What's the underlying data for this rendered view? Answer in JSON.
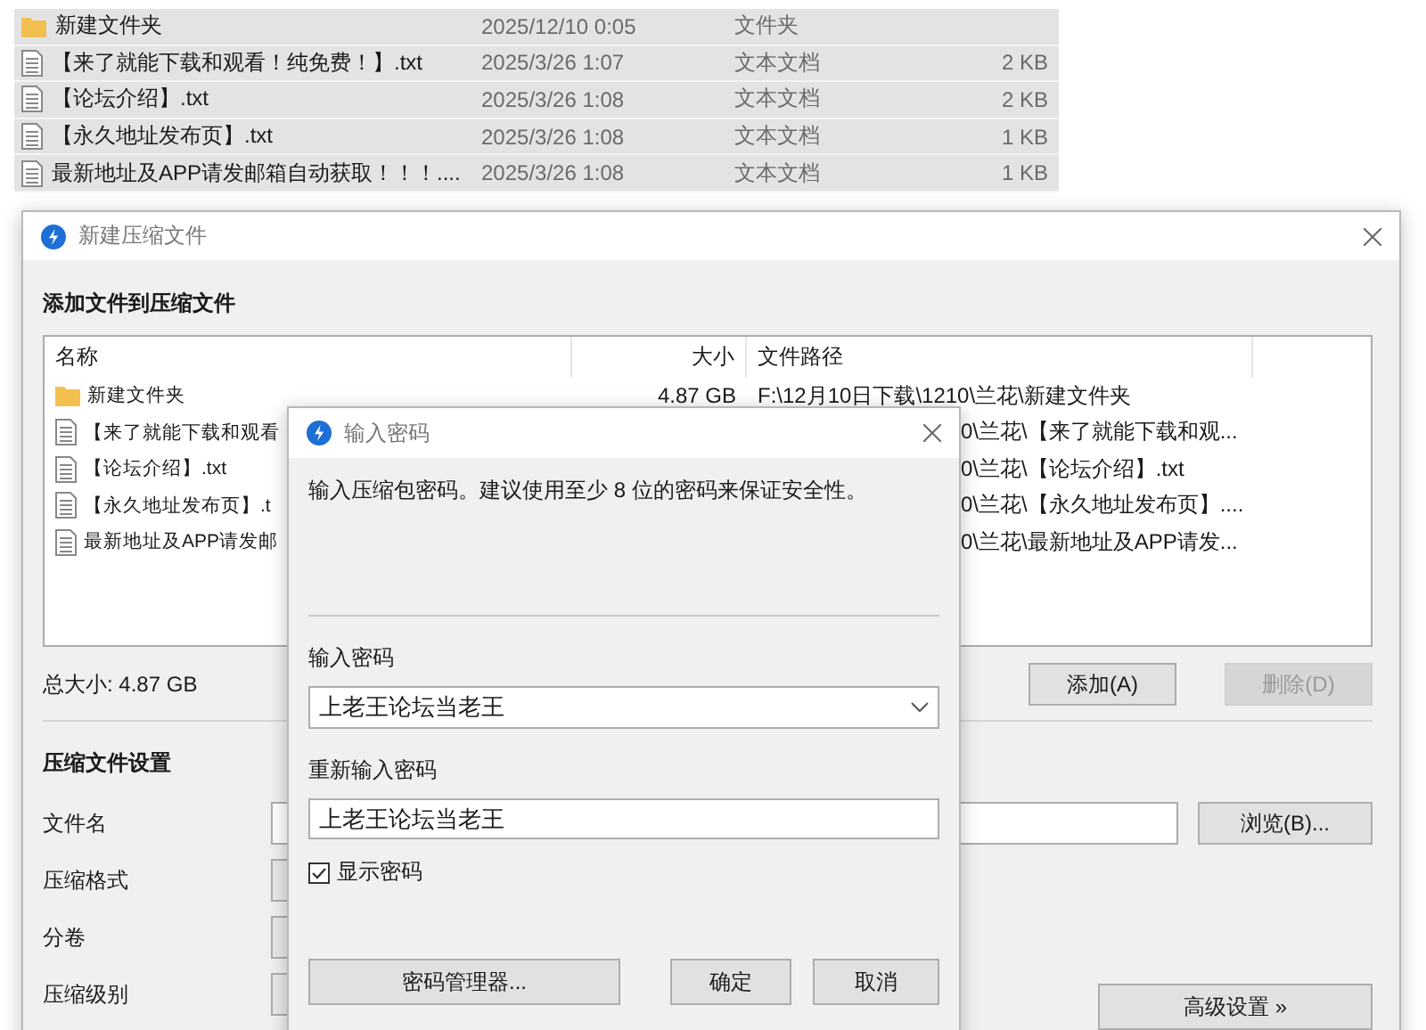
{
  "file_list": [
    {
      "kind": "folder",
      "name": "新建文件夹",
      "modified": "2025/12/10 0:05",
      "type": "文件夹"
    },
    {
      "kind": "text",
      "name": "【来了就能下载和观看！纯免费！】.txt",
      "modified": "2025/3/26 1:07",
      "type": "文本文档",
      "size": "2 KB"
    },
    {
      "kind": "text",
      "name": "【论坛介绍】.txt",
      "modified": "2025/3/26 1:08",
      "type": "文本文档",
      "size": "2 KB"
    },
    {
      "kind": "text",
      "name": "【永久地址发布页】.txt",
      "modified": "2025/3/26 1:08",
      "type": "文本文档",
      "size": "1 KB"
    },
    {
      "kind": "text",
      "name": "最新地址及APP请发邮箱自动获取！！！....",
      "modified": "2025/3/26 1:08",
      "type": "文本文档",
      "size": "1 KB"
    }
  ],
  "archive_window": {
    "title": "新建压缩文件",
    "section_title": "添加文件到压缩文件",
    "file_table": {
      "columns": [
        "名称",
        "大小",
        "文件路径"
      ],
      "rows": [
        {
          "kind": "folder",
          "name": "新建文件夹",
          "size": "4.87 GB",
          "path": "F:\\12月10日下载\\1210\\兰花\\新建文件夹"
        },
        {
          "kind": "text",
          "name": "【来了就能下载和观看",
          "path": "0\\兰花\\【来了就能下载和观..."
        },
        {
          "kind": "text",
          "name": "【论坛介绍】.txt",
          "path": "0\\兰花\\【论坛介绍】.txt"
        },
        {
          "kind": "text",
          "name": "【永久地址发布页】.t",
          "path": "0\\兰花\\【永久地址发布页】...."
        },
        {
          "kind": "text",
          "name": "最新地址及APP请发邮",
          "path": "0\\兰花\\最新地址及APP请发..."
        }
      ]
    },
    "total_size": "总大小: 4.87 GB",
    "buttons": [
      {
        "label": "添加(A)",
        "disabled": false
      },
      {
        "label": "删除(D)",
        "disabled": true
      }
    ],
    "settings_title": "压缩文件设置",
    "settings": [
      {
        "label": "文件名",
        "button": "浏览(B)..."
      },
      {
        "label": "压缩格式"
      },
      {
        "label": "分卷"
      },
      {
        "label": "压缩级别",
        "button": "高级设置 »"
      }
    ]
  },
  "password_dialog": {
    "title": "输入密码",
    "message": "输入压缩包密码。建议使用至少 8 位的密码来保证安全性。",
    "password_label": "输入密码",
    "password": "上老王论坛当老王",
    "confirm_label": "重新输入密码",
    "confirm": "上老王论坛当老王",
    "show_password": {
      "label": "显示密码",
      "checked": true
    },
    "buttons": [
      "密码管理器...",
      "确定",
      "取消"
    ]
  }
}
